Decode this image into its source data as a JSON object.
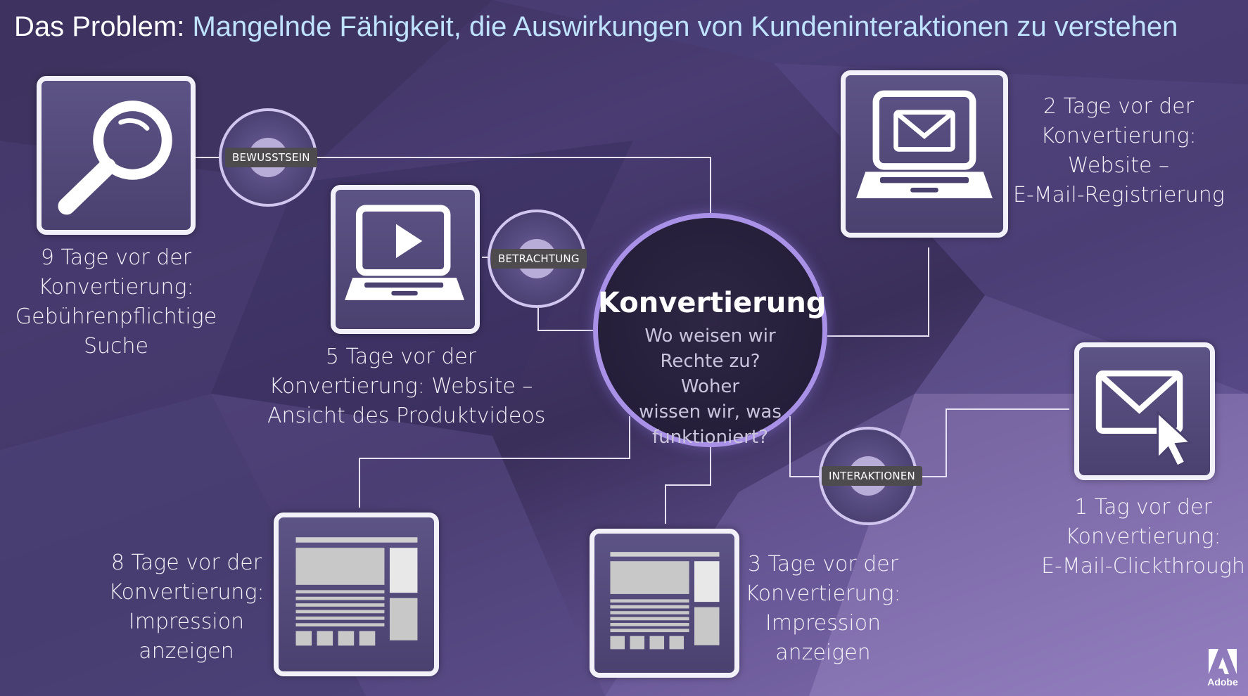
{
  "title": {
    "prefix": "Das Problem:",
    "main": "Mangelnde Fähigkeit, die Auswirkungen von Kundeninteraktionen zu verstehen"
  },
  "hub": {
    "title": "Konvertierung",
    "subtitle": "Wo weisen wir Rechte zu? Woher wissen wir, was funktioniert?"
  },
  "stages": [
    {
      "label": "BEWUSSTSEIN"
    },
    {
      "label": "BETRACHTUNG"
    },
    {
      "label": "INTERAKTIONEN"
    }
  ],
  "touchpoints": [
    {
      "icon": "magnifier-icon",
      "caption": "9 Tage vor der Konvertierung: Gebührenpflichtige Suche"
    },
    {
      "icon": "video-laptop-icon",
      "caption": "5 Tage vor der Konvertierung: Website – Ansicht des Produktvideos"
    },
    {
      "icon": "email-laptop-icon",
      "caption": "2 Tage vor der Konvertierung: Website – E-Mail-Registrierung"
    },
    {
      "icon": "email-click-icon",
      "caption": "1 Tag vor der Konvertierung: E-Mail-Clickthrough"
    },
    {
      "icon": "display-ad-icon",
      "caption": "8 Tage vor der Konvertierung: Impression anzeigen"
    },
    {
      "icon": "display-ad-icon",
      "caption": "3 Tage vor der Konvertierung: Impression anzeigen"
    }
  ],
  "captions_lines": {
    "c9": [
      "9 Tage vor der",
      "Konvertierung:",
      "Gebührenpflichtige",
      "Suche"
    ],
    "c5": [
      "5 Tage vor der",
      "Konvertierung: Website –",
      "Ansicht des Produktvideos"
    ],
    "c2": [
      "2 Tage vor der",
      "Konvertierung:",
      "Website –",
      "E-Mail-Registrierung"
    ],
    "c1": [
      "1 Tag vor der",
      "Konvertierung:",
      "E-Mail-Clickthrough"
    ],
    "c8": [
      "8 Tage vor der",
      "Konvertierung:",
      "Impression",
      "anzeigen"
    ],
    "c3": [
      "3 Tage vor der",
      "Konvertierung:",
      "Impression",
      "anzeigen"
    ]
  },
  "hub_lines": [
    "Wo weisen wir",
    "Rechte zu? Woher",
    "wissen wir, was",
    "funktioniert?"
  ],
  "brand": {
    "name": "Adobe"
  },
  "colors": {
    "accent": "#a891e6",
    "title_main": "#bfe3ff"
  }
}
